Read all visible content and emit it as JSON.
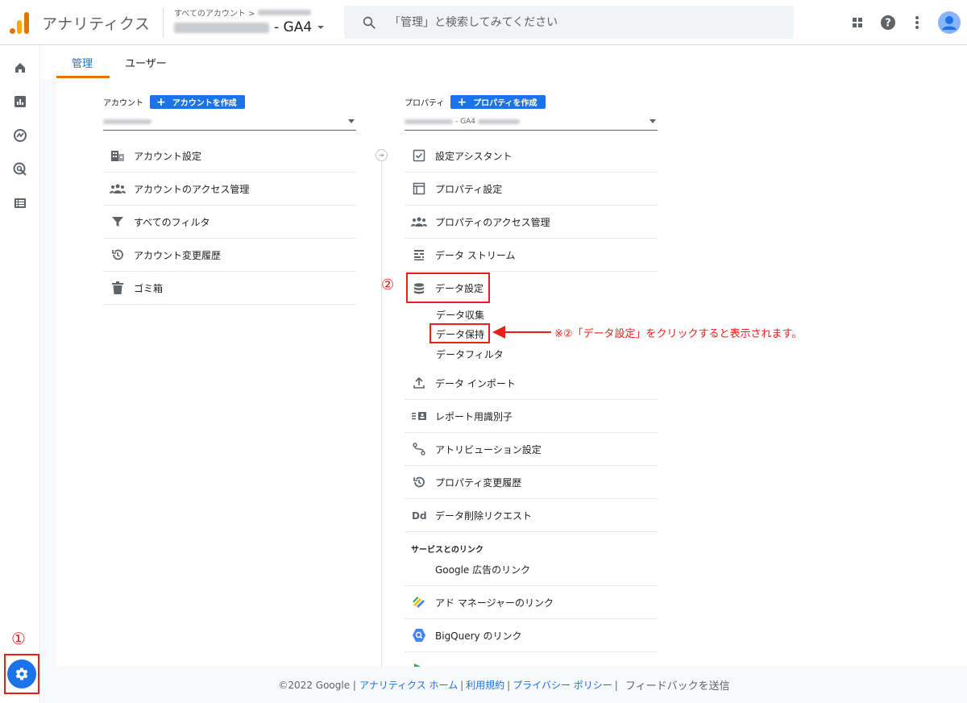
{
  "header": {
    "app_title": "アナリティクス",
    "breadcrumb_prefix": "すべてのアカウント >",
    "property_suffix": "- GA4",
    "search_placeholder": "「管理」と検索してみてください"
  },
  "tabs": {
    "admin": "管理",
    "user": "ユーザー"
  },
  "account": {
    "header_label": "アカウント",
    "create_button": "アカウントを作成",
    "items": [
      {
        "label": "アカウント設定"
      },
      {
        "label": "アカウントのアクセス管理"
      },
      {
        "label": "すべてのフィルタ"
      },
      {
        "label": "アカウント変更履歴"
      },
      {
        "label": "ゴミ箱"
      }
    ]
  },
  "property": {
    "header_label": "プロパティ",
    "create_button": "プロパティを作成",
    "selector_suffix": "- GA4",
    "items_top": [
      {
        "label": "設定アシスタント"
      },
      {
        "label": "プロパティ設定"
      },
      {
        "label": "プロパティのアクセス管理"
      },
      {
        "label": "データ ストリーム"
      },
      {
        "label": "データ設定"
      }
    ],
    "data_settings_sub": [
      {
        "label": "データ収集"
      },
      {
        "label": "データ保持"
      },
      {
        "label": "データフィルタ"
      }
    ],
    "items_bottom": [
      {
        "label": "データ インポート"
      },
      {
        "label": "レポート用識別子"
      },
      {
        "label": "アトリビューション設定"
      },
      {
        "label": "プロパティ変更履歴"
      },
      {
        "label": "データ削除リクエスト"
      }
    ],
    "links_section_label": "サービスとのリンク",
    "links": [
      {
        "label": "Google 広告のリンク"
      },
      {
        "label": "アド マネージャーのリンク"
      },
      {
        "label": "BigQuery のリンク"
      }
    ]
  },
  "annotations": {
    "marker1": "①",
    "marker2": "②",
    "note": "※②「データ設定」をクリックすると表示されます。"
  },
  "footer": {
    "copyright": "©2022 Google |",
    "link_home": "アナリティクス ホーム",
    "link_terms": "利用規約",
    "link_privacy": "プライバシー ポリシー",
    "feedback": "フィードバックを送信"
  },
  "colors": {
    "accent": "#1a73e8",
    "orange": "#e37400",
    "annotation_red": "#e8201a"
  }
}
